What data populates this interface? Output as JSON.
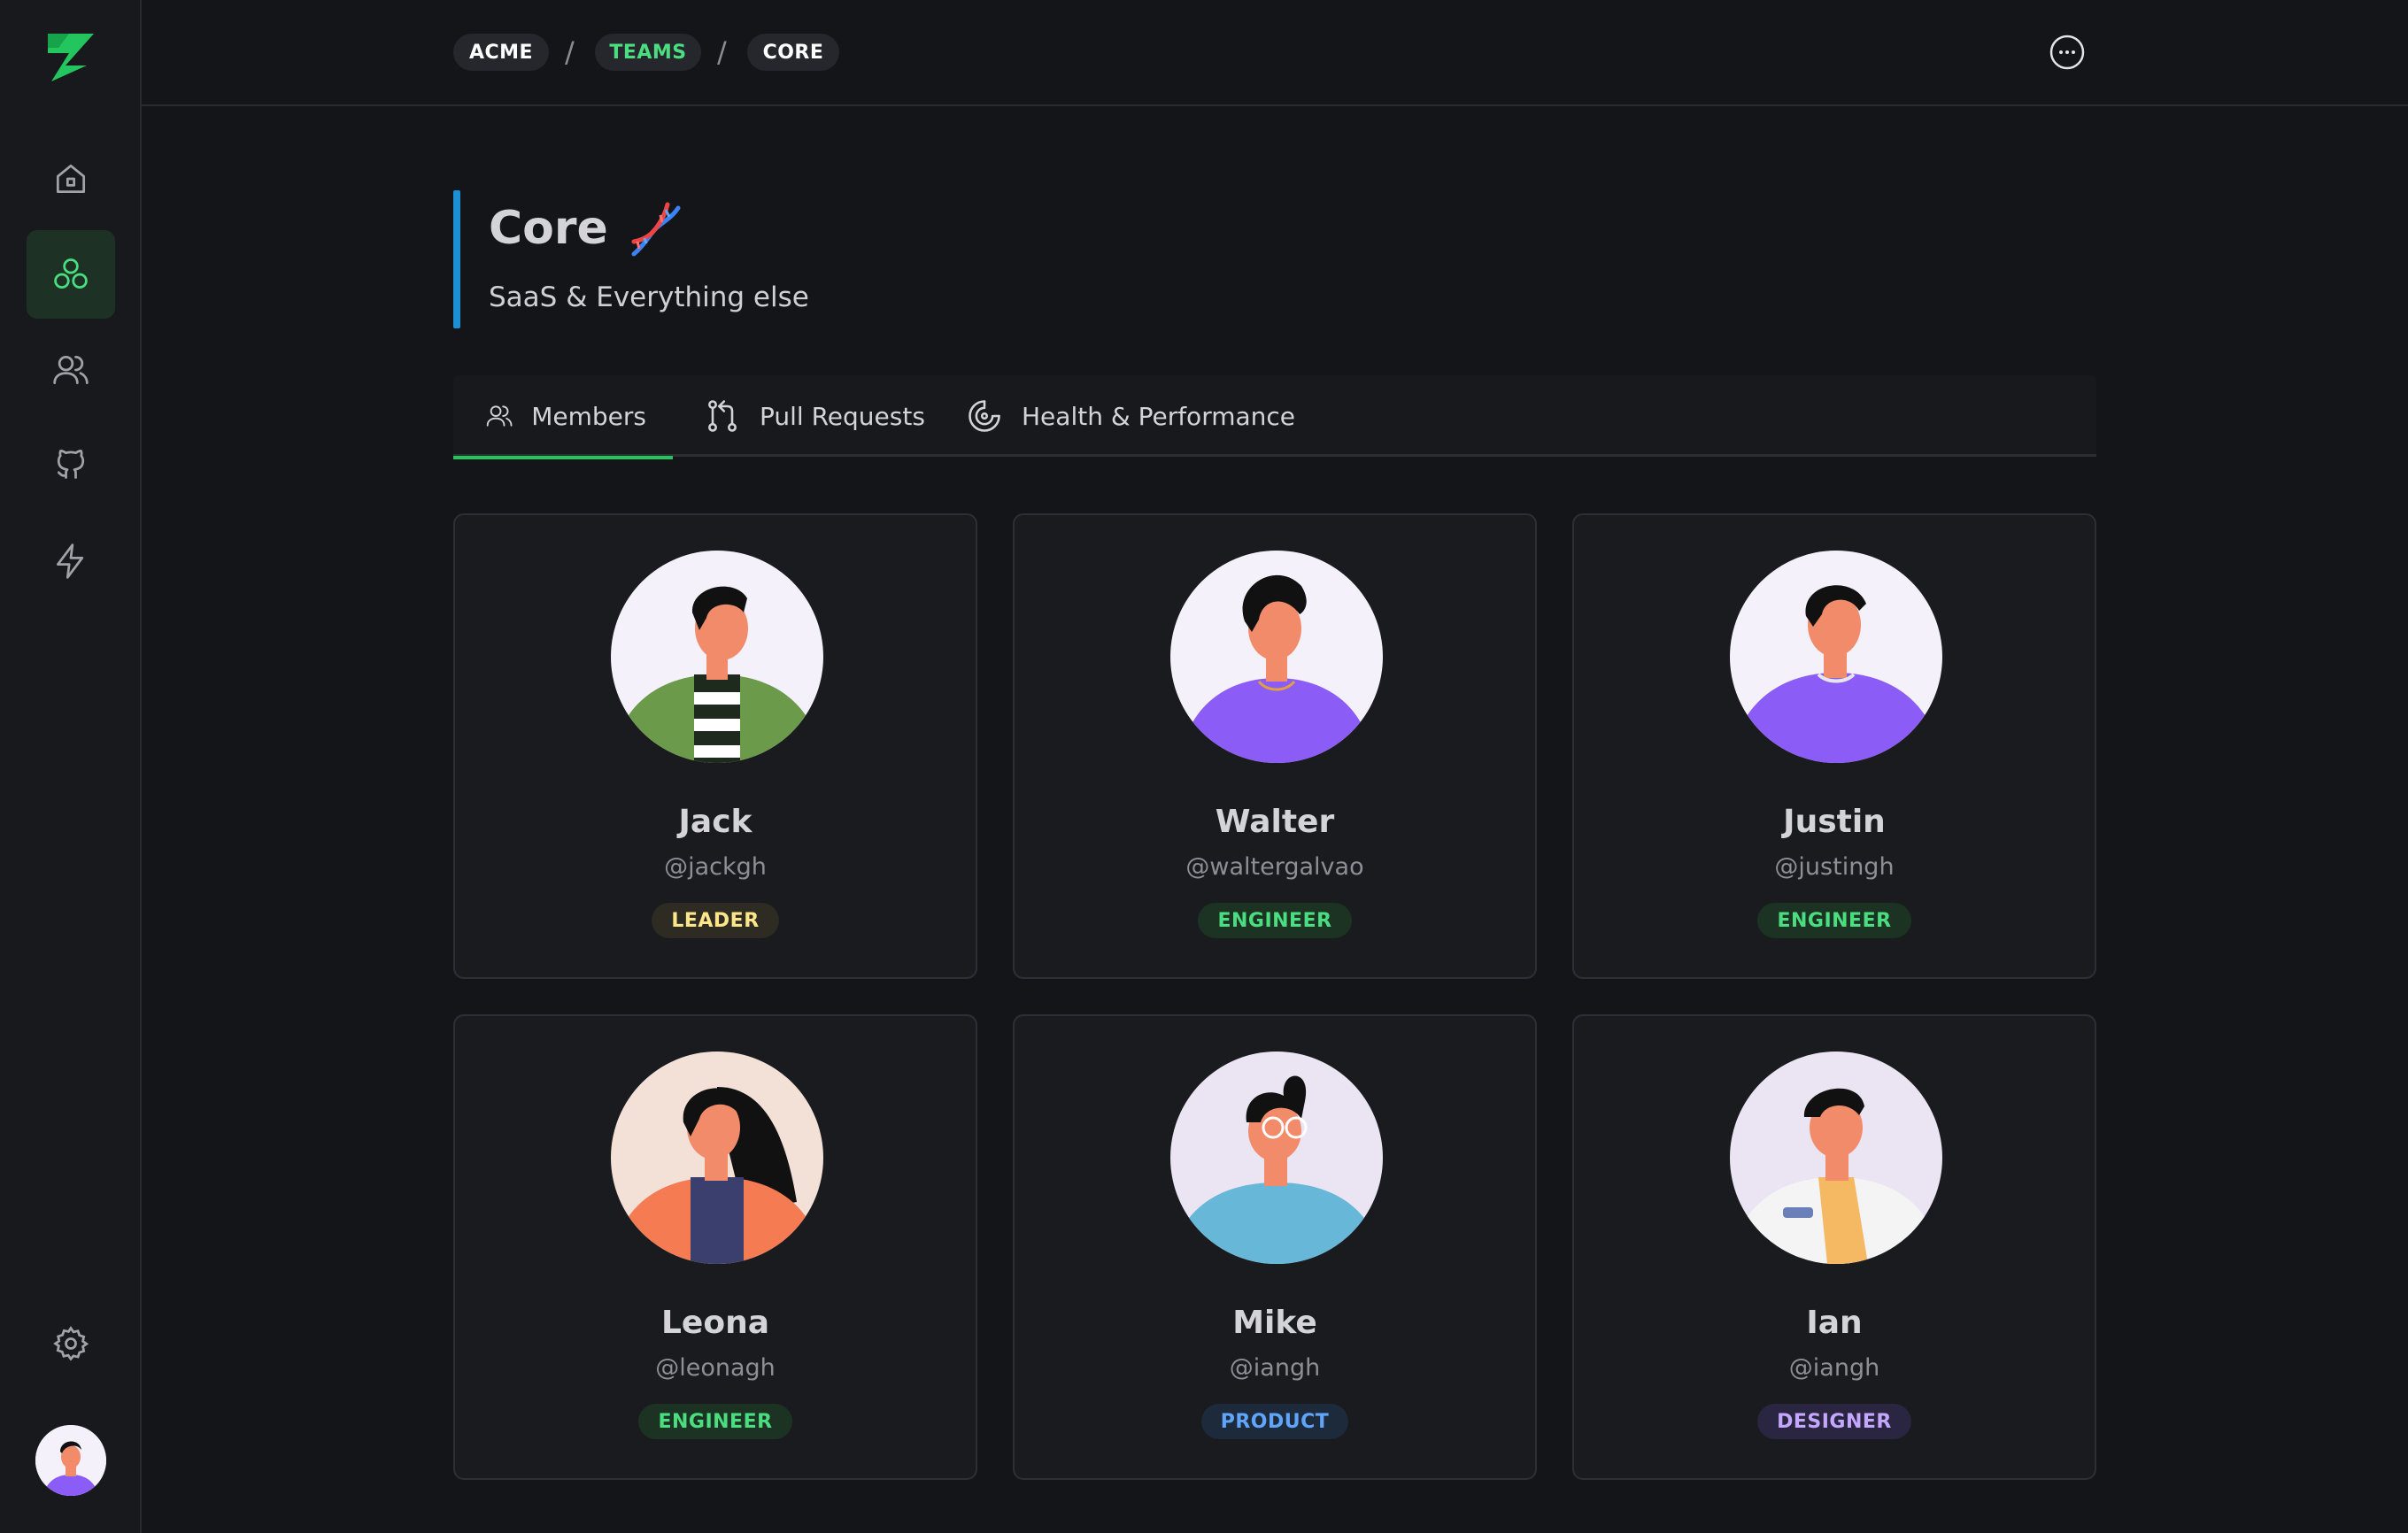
{
  "sidebar": {
    "items": [
      {
        "icon": "home-icon"
      },
      {
        "icon": "teams-icon",
        "active": true
      },
      {
        "icon": "users-icon"
      },
      {
        "icon": "github-icon"
      },
      {
        "icon": "lightning-icon"
      },
      {
        "icon": "gear-icon"
      }
    ]
  },
  "breadcrumb": {
    "items": [
      "ACME",
      "TEAMS",
      "CORE"
    ],
    "separator": "/"
  },
  "header": {
    "title": "Core",
    "title_icon": "dna-icon",
    "subtitle": "SaaS & Everything else"
  },
  "tabs": [
    {
      "label": "Members",
      "icon": "users-icon",
      "active": true
    },
    {
      "label": "Pull Requests",
      "icon": "pull-request-icon"
    },
    {
      "label": "Health & Performance",
      "icon": "gauge-icon"
    }
  ],
  "members": [
    {
      "name": "Jack",
      "handle": "@jackgh",
      "role": "LEADER"
    },
    {
      "name": "Walter",
      "handle": "@waltergalvao",
      "role": "ENGINEER"
    },
    {
      "name": "Justin",
      "handle": "@justingh",
      "role": "ENGINEER"
    },
    {
      "name": "Leona",
      "handle": "@leonagh",
      "role": "ENGINEER"
    },
    {
      "name": "Mike",
      "handle": "@iangh",
      "role": "PRODUCT"
    },
    {
      "name": "Ian",
      "handle": "@iangh",
      "role": "DESIGNER"
    }
  ],
  "colors": {
    "accent": "#22c55e",
    "header_bar": "#1d8fd4",
    "background": "#141518"
  }
}
